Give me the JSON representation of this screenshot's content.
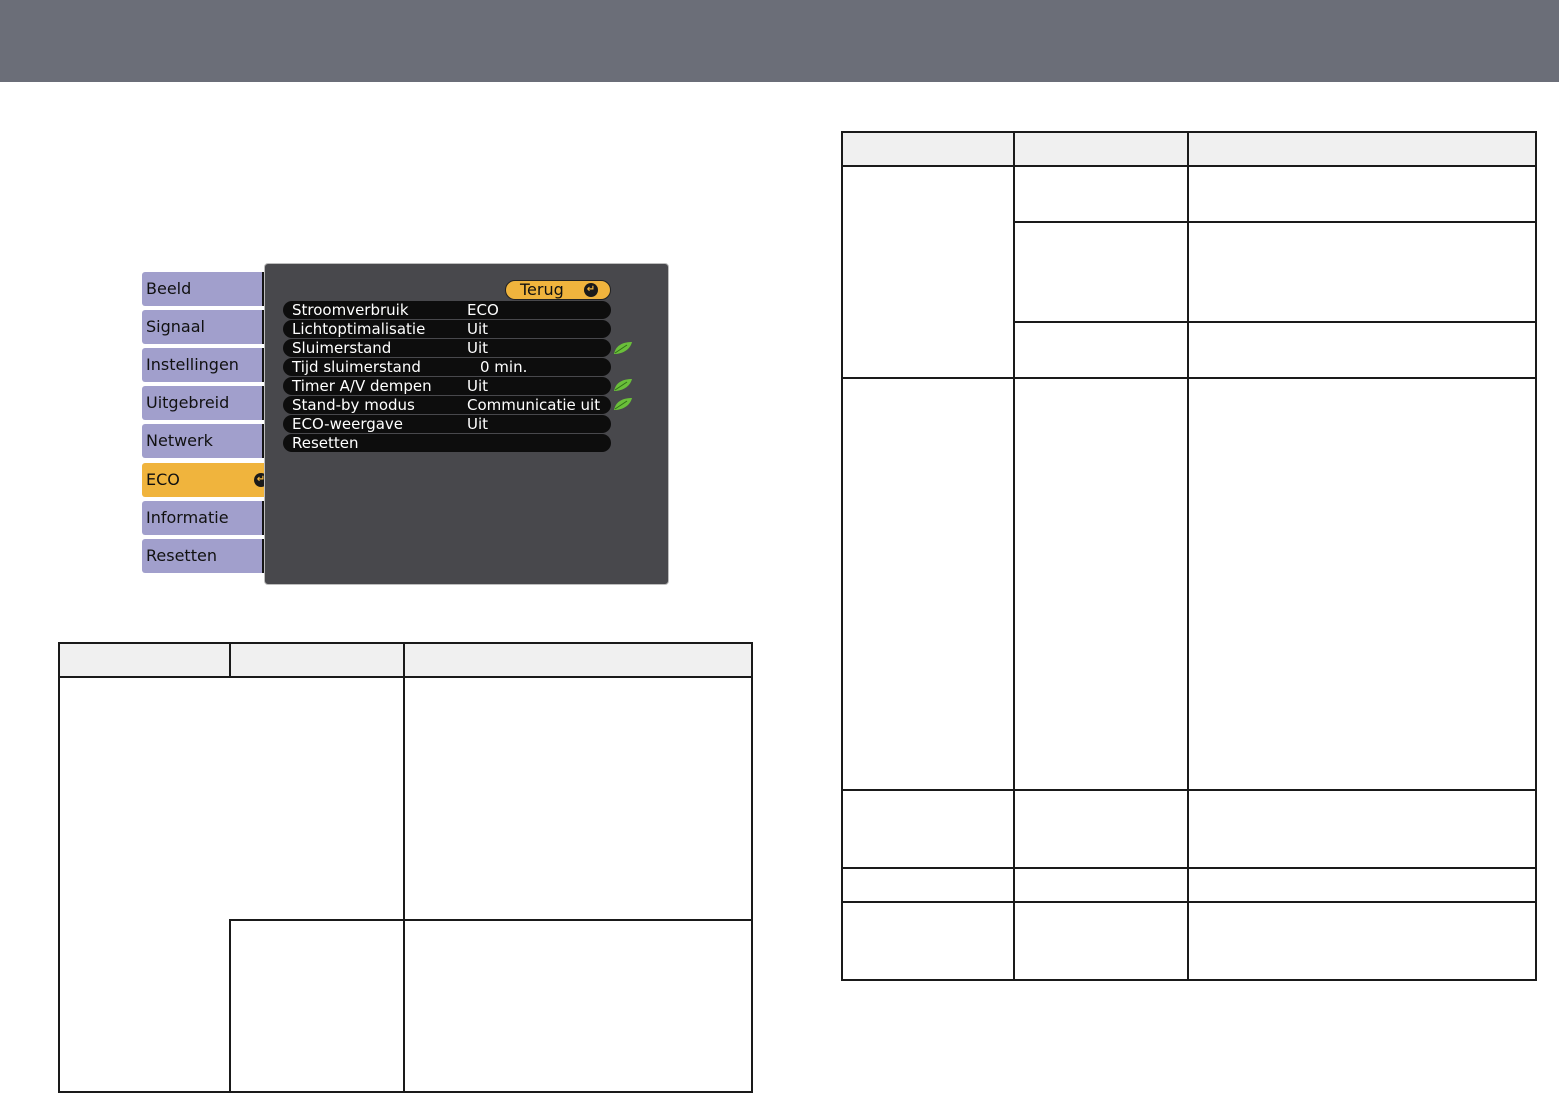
{
  "menu": {
    "tabs": [
      {
        "label": "Beeld"
      },
      {
        "label": "Signaal"
      },
      {
        "label": "Instellingen"
      },
      {
        "label": "Uitgebreid"
      },
      {
        "label": "Netwerk"
      },
      {
        "label": "ECO",
        "active": true
      },
      {
        "label": "Informatie"
      },
      {
        "label": "Resetten"
      }
    ],
    "back_label": "Terug",
    "settings": [
      {
        "label": "Stroomverbruik",
        "value": "ECO"
      },
      {
        "label": "Lichtoptimalisatie",
        "value": "Uit"
      },
      {
        "label": "Sluimerstand",
        "value": "Uit",
        "eco_icon": true
      },
      {
        "label": "Tijd sluimerstand",
        "value": "0 min."
      },
      {
        "label": "Timer A/V dempen",
        "value": "Uit",
        "eco_icon": true
      },
      {
        "label": "Stand-by modus",
        "value": "Communicatie uit",
        "eco_icon": true
      },
      {
        "label": "ECO-weergave",
        "value": "Uit"
      },
      {
        "label": "Resetten",
        "value": ""
      }
    ]
  },
  "colors": {
    "header_bar": "#6b6e78",
    "tab_inactive": "#a19fcc",
    "tab_active": "#f0b43d",
    "panel_bg": "#48484c",
    "eco_leaf": "#6abf3a"
  },
  "icons": {
    "enter": "enter-return-icon",
    "eco": "leaf-icon"
  }
}
